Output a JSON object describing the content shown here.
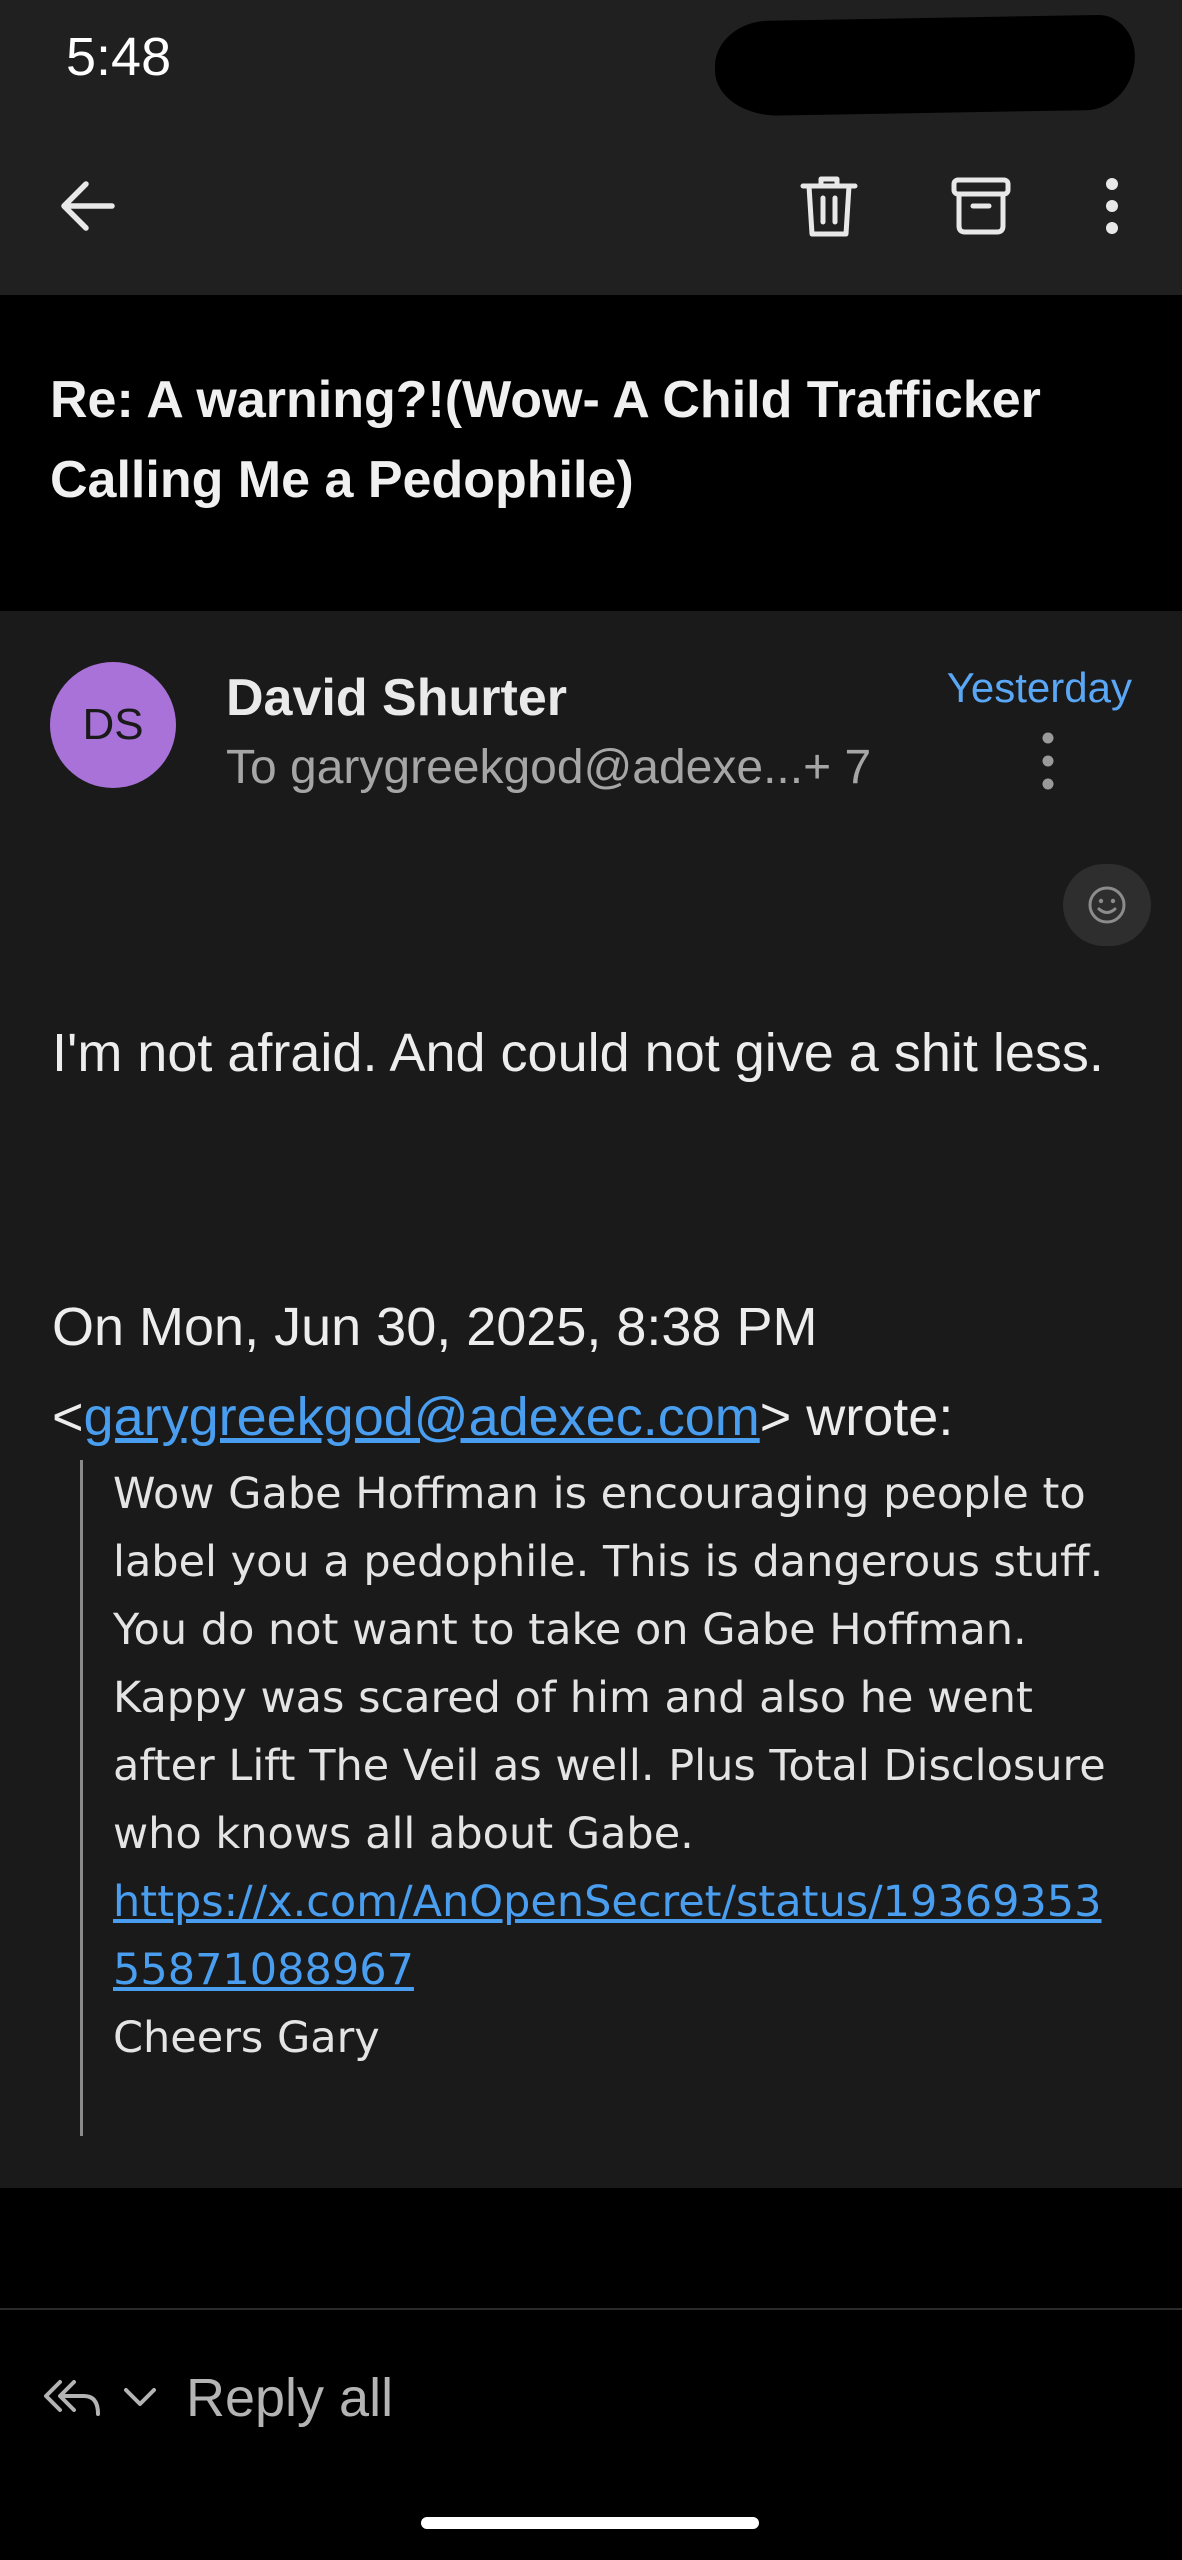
{
  "status_bar": {
    "time": "5:48"
  },
  "toolbar": {
    "back_icon": "arrow-left-icon",
    "delete_icon": "trash-icon",
    "archive_icon": "archive-icon",
    "more_icon": "more-vertical-icon"
  },
  "email": {
    "subject": "Re: A warning?!(Wow- A Child Trafficker Calling Me a Pedophile)",
    "sender": {
      "initials": "DS",
      "name": "David Shurter",
      "avatar_color": "#a872d8"
    },
    "recipients": "To garygreekgod@adexe...+ 7",
    "date": "Yesterday",
    "body": "I'm not afraid. And could not give a shit less.",
    "attribution": {
      "line1": "On Mon, Jun 30, 2025, 8:38 PM",
      "open_bracket": "<",
      "email": "garygreekgod@adexec.com",
      "close": "> wrote:"
    },
    "quoted": {
      "text": "Wow Gabe Hoffman is encouraging people to label you a pedophile. This is dangerous stuff. You do not want to take on Gabe Hoffman. Kappy was scared of him and also he went after Lift The Veil as well. Plus Total Disclosure who knows all about Gabe.",
      "url": "https://x.com/AnOpenSecret/status/1936935355871088967",
      "signoff": "Cheers Gary"
    }
  },
  "reply_bar": {
    "label": "Reply all"
  },
  "colors": {
    "link": "#4a9ef0",
    "date_accent": "#5aa7f5",
    "toolbar_bg": "#202020",
    "card_bg": "#1a1a1a"
  }
}
